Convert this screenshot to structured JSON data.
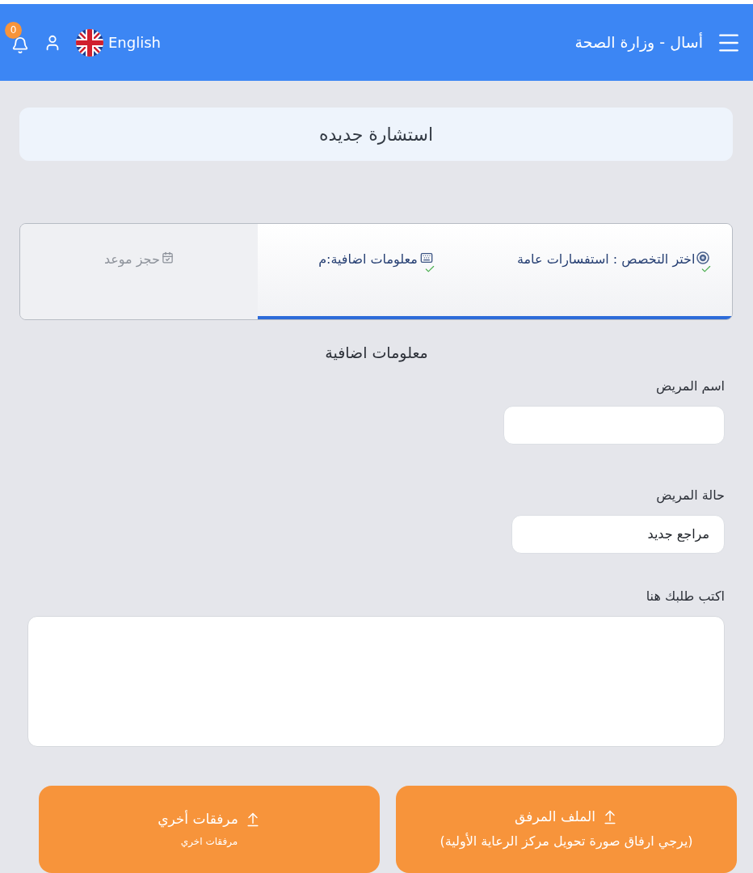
{
  "header": {
    "title": "أسال - وزارة الصحة",
    "language": "English",
    "notification_count": "0"
  },
  "page_title": "استشارة جديده",
  "steps": [
    {
      "kind": "specialty",
      "label": "اختر التخصص : استفسارات عامة",
      "done": true
    },
    {
      "kind": "info",
      "label": "معلومات اضافية:م",
      "done": true
    },
    {
      "kind": "appointment",
      "label": "حجز موعد",
      "done": false
    }
  ],
  "section_title": "معلومات اضافية",
  "fields": [
    {
      "kind": "input",
      "label": "اسم المريض"
    },
    {
      "kind": "input",
      "label": "حالة المريض",
      "value": "مراجع جديد"
    },
    {
      "kind": "textarea",
      "label": "اكتب طلبك هنا"
    }
  ],
  "upload_buttons": [
    {
      "kind": "main",
      "label": "الملف المرفق",
      "hint": "(يرجي ارفاق صورة تحويل مركز الرعاية الأولية)"
    },
    {
      "kind": "extra",
      "label": "مرفقات أخري",
      "hint": "مرفقات اخري"
    }
  ]
}
